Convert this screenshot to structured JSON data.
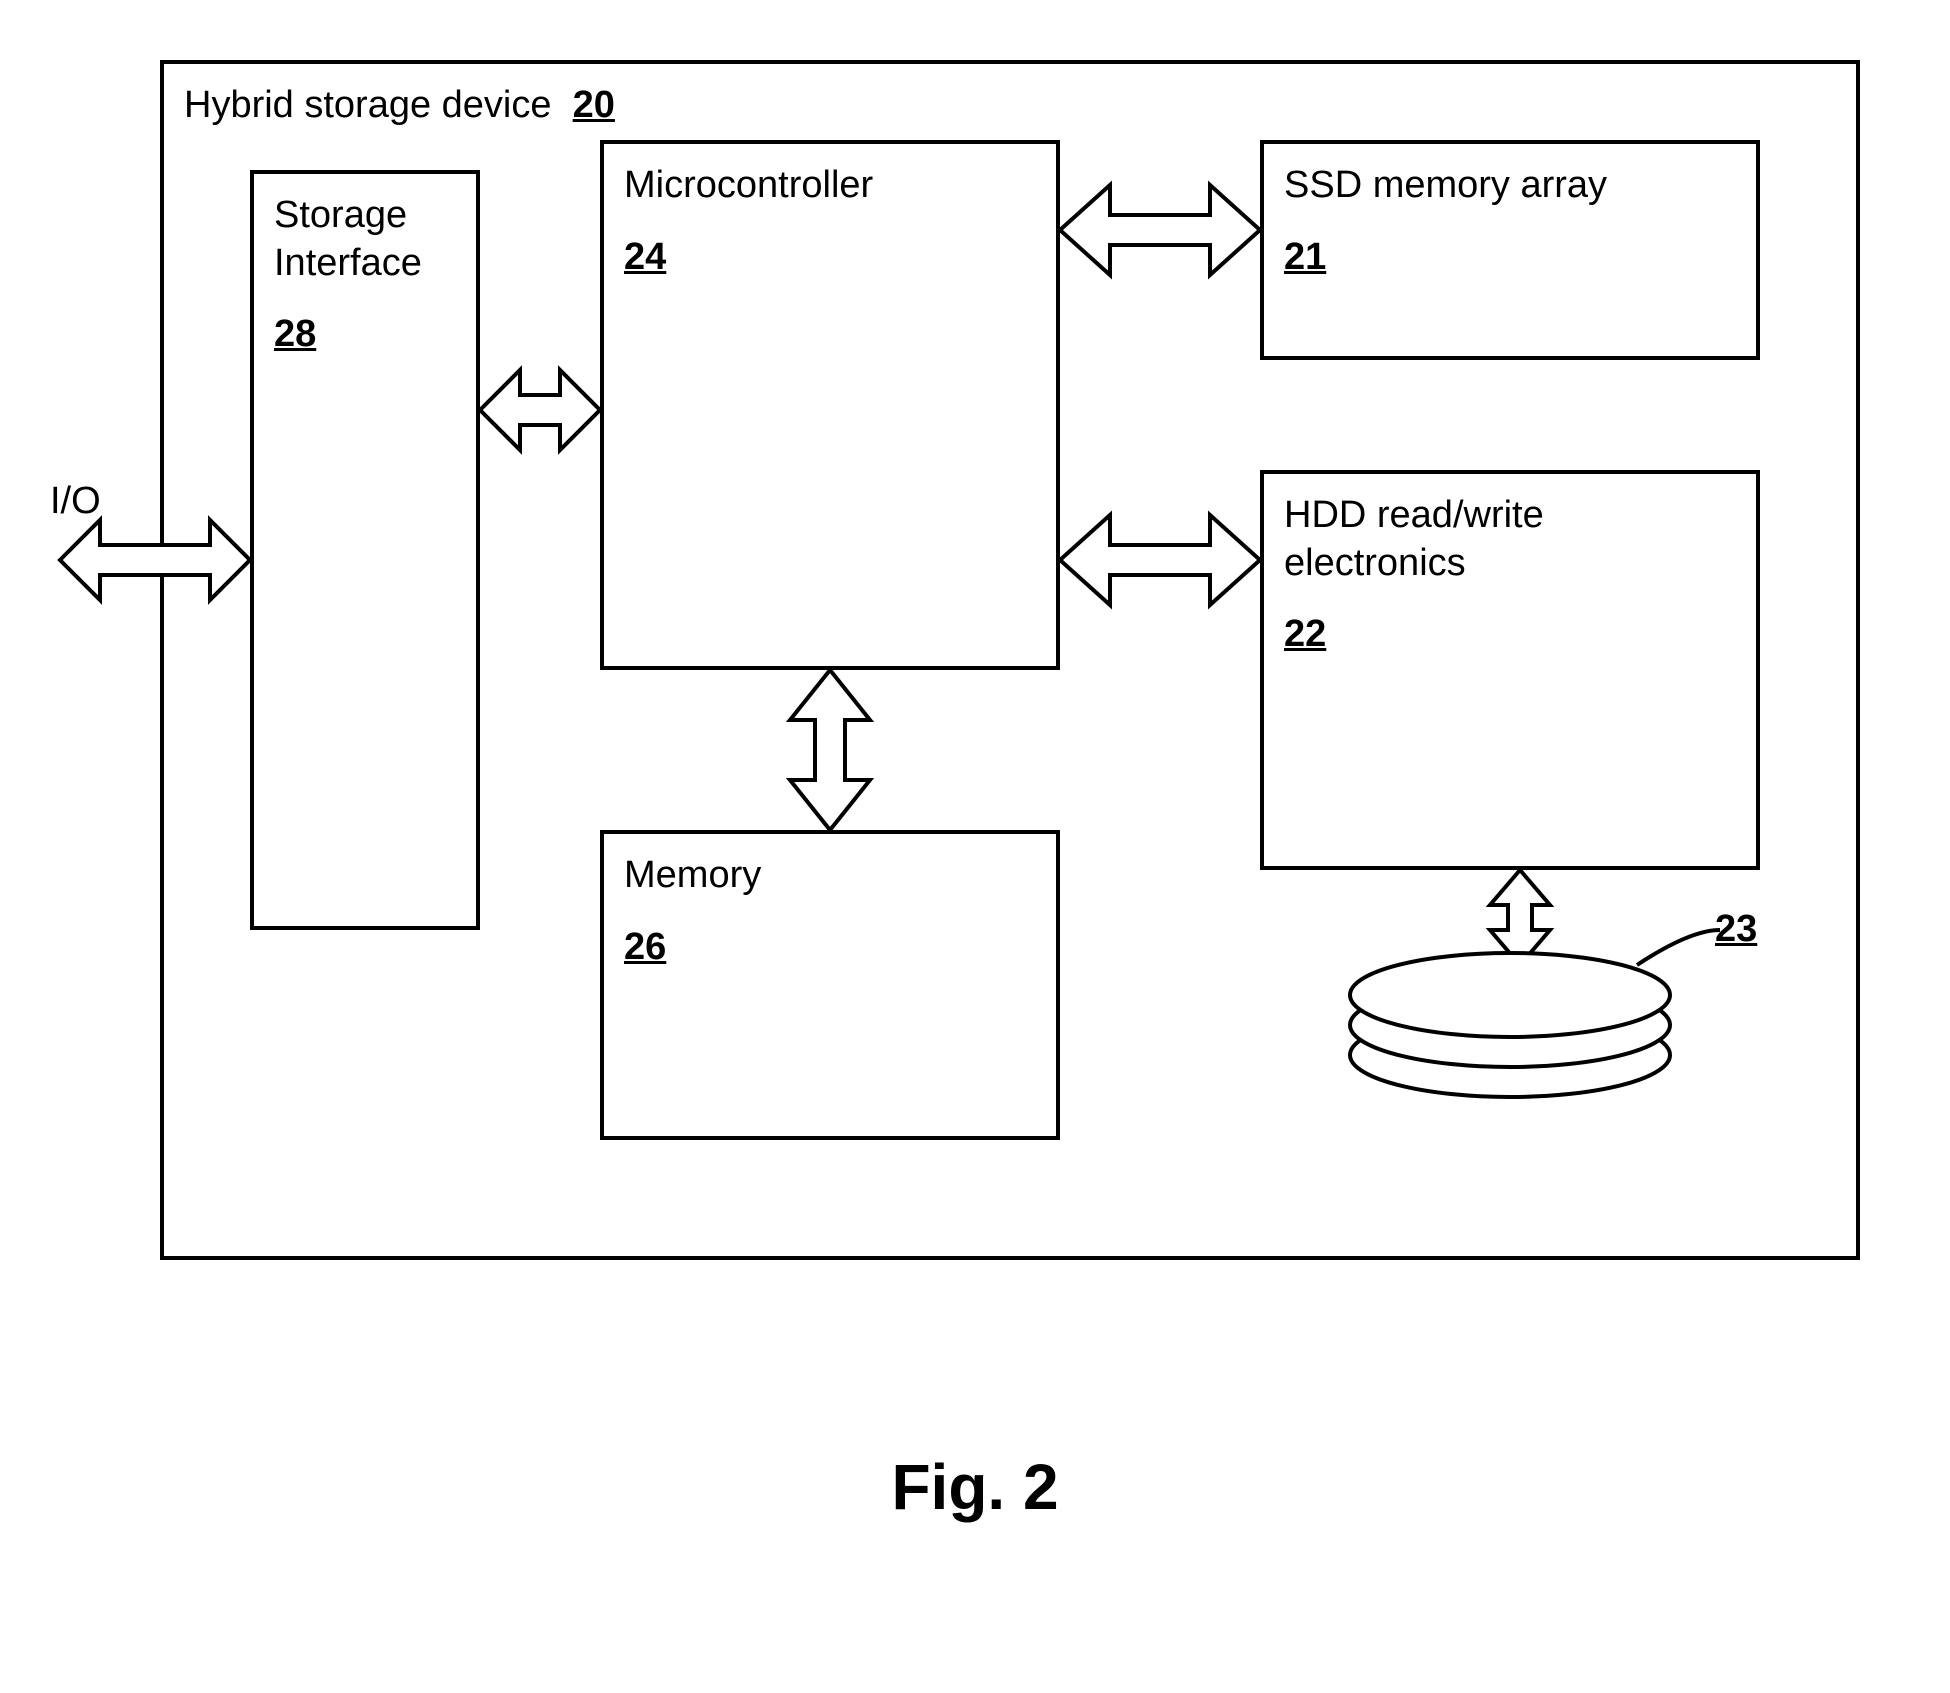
{
  "figure_label": "Fig. 2",
  "io_label": "I/O",
  "outer": {
    "label": "Hybrid storage device",
    "ref": "20"
  },
  "storage_interface": {
    "label": "Storage\nInterface",
    "ref": "28"
  },
  "microcontroller": {
    "label": "Microcontroller",
    "ref": "24"
  },
  "ssd": {
    "label": "SSD memory array",
    "ref": "21"
  },
  "hdd": {
    "label": "HDD read/write\nelectronics",
    "ref": "22"
  },
  "memory": {
    "label": "Memory",
    "ref": "26"
  },
  "platters": {
    "ref": "23"
  }
}
